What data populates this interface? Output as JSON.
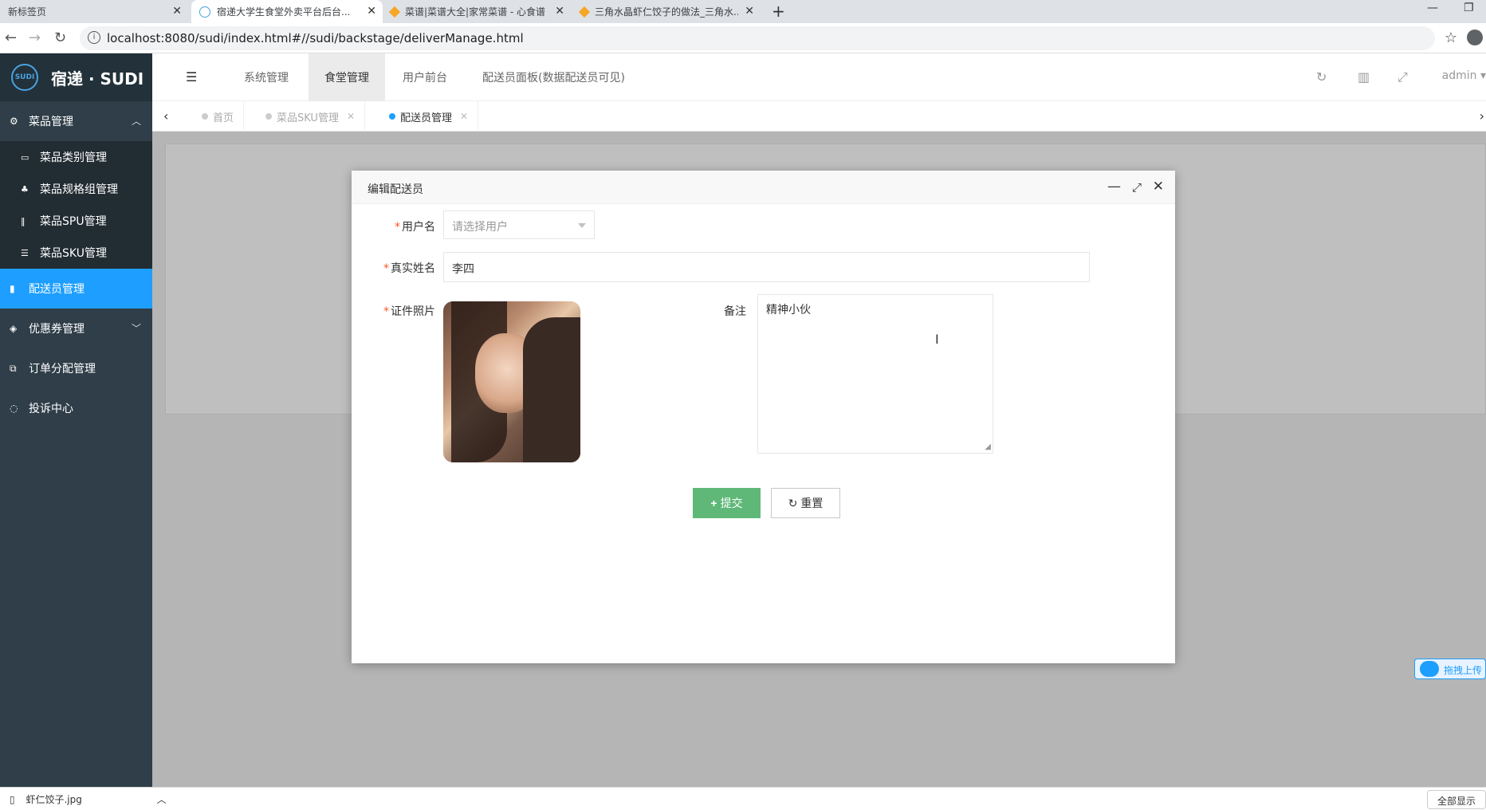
{
  "browser": {
    "tabs": [
      {
        "title": "新标签页"
      },
      {
        "title": "宿递大学生食堂外卖平台后台..."
      },
      {
        "title": "菜谱|菜谱大全|家常菜谱 - 心食谱"
      },
      {
        "title": "三角水晶虾仁饺子的做法_三角水..."
      }
    ],
    "url": "localhost:8080/sudi/index.html#//sudi/backstage/deliverManage.html"
  },
  "app": {
    "logo_badge": "SUDI",
    "logo_text": "宿递 · SUDI"
  },
  "sidebar": {
    "group_dish": "菜品管理",
    "sub_items": [
      "菜品类别管理",
      "菜品规格组管理",
      "菜品SPU管理",
      "菜品SKU管理"
    ],
    "deliver": "配送员管理",
    "coupon": "优惠券管理",
    "order": "订单分配管理",
    "complaint": "投诉中心"
  },
  "header": {
    "nav": [
      "系统管理",
      "食堂管理",
      "用户前台",
      "配送员面板(数据配送员可见)"
    ],
    "admin": "admin"
  },
  "page_tabs": [
    {
      "label": "首页"
    },
    {
      "label": "菜品SKU管理"
    },
    {
      "label": "配送员管理"
    }
  ],
  "dialog": {
    "title": "编辑配送员",
    "username_label": "用户名",
    "username_placeholder": "请选择用户",
    "realname_label": "真实姓名",
    "realname_value": "李四",
    "photo_label": "证件照片",
    "remark_label": "备注",
    "remark_value": "精神小伙",
    "submit": "提交",
    "reset": "重置"
  },
  "download_bar": {
    "file": "虾仁饺子.jpg",
    "show_all": "全部显示"
  },
  "upload_widget": "拖拽上传"
}
